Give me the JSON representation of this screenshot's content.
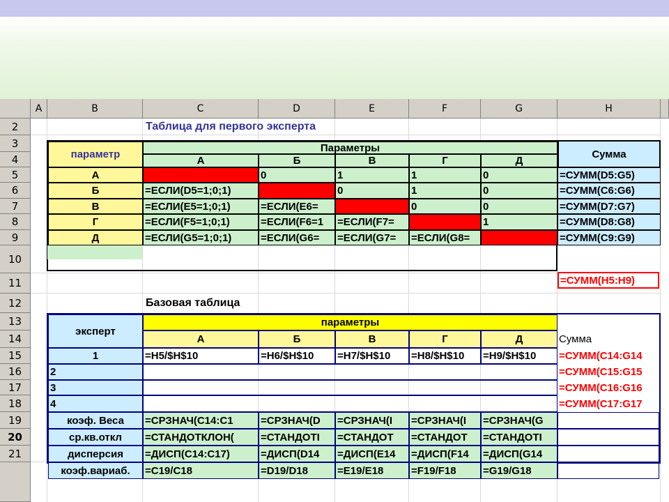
{
  "columns": [
    "A",
    "B",
    "C",
    "D",
    "E",
    "F",
    "G",
    "H"
  ],
  "rows": [
    "2",
    "3",
    "4",
    "5",
    "6",
    "7",
    "8",
    "9",
    "10",
    "11",
    "12",
    "13",
    "14",
    "15",
    "16",
    "17",
    "18",
    "19",
    "20",
    "21"
  ],
  "selected_row": "20",
  "table1": {
    "title": "Таблица для первого эксперта",
    "row_header": "параметр",
    "group_header": "Параметры",
    "sum_header": "Сумма",
    "params": [
      "А",
      "Б",
      "В",
      "Г",
      "Д"
    ],
    "cells": [
      [
        "",
        "0",
        "1",
        "1",
        "0"
      ],
      [
        "=ЕСЛИ(D5=1;0;1)",
        "",
        "0",
        "1",
        "0"
      ],
      [
        "=ЕСЛИ(E5=1;0;1)",
        "=ЕСЛИ(E6=",
        "",
        "0",
        "0"
      ],
      [
        "=ЕСЛИ(F5=1;0;1)",
        "=ЕСЛИ(F6=1",
        "=ЕСЛИ(F7=",
        "",
        "1"
      ],
      [
        "=ЕСЛИ(G5=1;0;1)",
        "=ЕСЛИ(G6=",
        "=ЕСЛИ(G7=",
        "=ЕСЛИ(G8=",
        ""
      ]
    ],
    "sums": [
      "=СУММ(D5:G5)",
      "=СУММ(C6:G6)",
      "=СУММ(D7:G7)",
      "=СУММ(D8:G8)",
      "=СУММ(C9:G9)"
    ],
    "total": "=СУММ(H5:H9)"
  },
  "table2": {
    "title": "Базовая таблица",
    "row_header": "эксперт",
    "group_header": "параметры",
    "sum_header": "Сумма",
    "params": [
      "А",
      "Б",
      "В",
      "Г",
      "Д"
    ],
    "experts": [
      "1",
      "2",
      "3",
      "4"
    ],
    "expert1_cells": [
      "=H5/$H$10",
      "=H6/$H$10",
      "=H7/$H$10",
      "=H8/$H$10",
      "=H9/$H$10"
    ],
    "sums": [
      "=СУММ(C14:G14",
      "=СУММ(C15:G15",
      "=СУММ(C16:G16",
      "=СУММ(C17:G17"
    ],
    "stats": [
      {
        "label": "коэф. Веса",
        "cells": [
          "=СРЗНАЧ(C14:C1",
          "=СРЗНАЧ(D",
          "=СРЗНАЧ(I",
          "=СРЗНАЧ(I",
          "=СРЗНАЧ(G"
        ]
      },
      {
        "label": "ср.кв.откл",
        "cells": [
          "=СТАНДОТКЛОН(",
          "=СТАНДОТI",
          "=СТАНДОТ",
          "=СТАНДОТ",
          "=СТАНДОТI"
        ]
      },
      {
        "label": "дисперсия",
        "cells": [
          "=ДИСП(C14:C17)",
          "=ДИСП(D14",
          "=ДИСП(E14",
          "=ДИСП(F14",
          "=ДИСП(G14"
        ]
      },
      {
        "label": "коэф.вариаб.",
        "cells": [
          "=C19/C18",
          "=D19/D18",
          "=E19/E18",
          "=F19/F18",
          "=G19/G18"
        ]
      }
    ]
  },
  "colors": {
    "header_band": "#c8c8ee",
    "title_blue": "#333399",
    "red_fill": "#ff0000",
    "yellow": "#fff799",
    "green": "#ccf0cc",
    "cyan": "#ccecff"
  }
}
